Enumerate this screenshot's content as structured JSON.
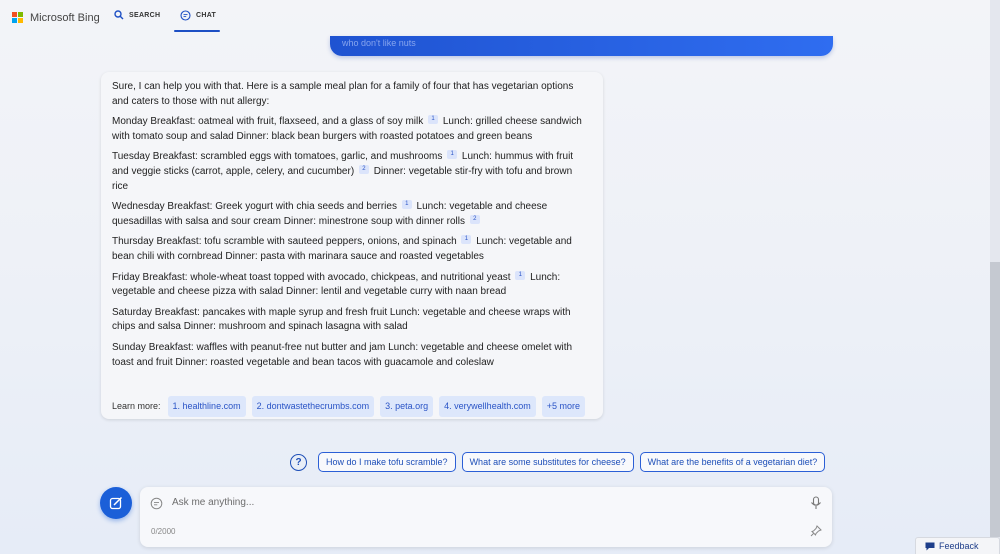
{
  "header": {
    "logo_text": "Microsoft Bing",
    "nav_search": "SEARCH",
    "nav_chat": "CHAT"
  },
  "user_bubble": {
    "text": "who don't like nuts"
  },
  "answer": {
    "intro": "Sure, I can help you with that. Here is a sample meal plan for a family of four that has vegetarian options and caters to those with nut allergy:",
    "days": [
      {
        "a": "Monday Breakfast: oatmeal with fruit, flaxseed, and a glass of soy milk",
        "c1": "1",
        "b": "Lunch: grilled cheese sandwich with tomato soup and salad Dinner: black bean burgers with roasted potatoes and green beans"
      },
      {
        "a": "Tuesday Breakfast: scrambled eggs with tomatoes, garlic, and mushrooms",
        "c1": "1",
        "b": "Lunch: hummus with fruit and veggie sticks (carrot, apple, celery, and cucumber)",
        "c2": "2",
        "c": "Dinner: vegetable stir-fry with tofu and brown rice"
      },
      {
        "a": "Wednesday Breakfast: Greek yogurt with chia seeds and berries",
        "c1": "1",
        "b": "Lunch: vegetable and cheese quesadillas with salsa and sour cream Dinner: minestrone soup with dinner rolls",
        "c2": "2"
      },
      {
        "a": "Thursday Breakfast: tofu scramble with sauteed peppers, onions, and spinach",
        "c1": "1",
        "b": "Lunch: vegetable and bean chili with cornbread Dinner: pasta with marinara sauce and roasted vegetables"
      },
      {
        "a": "Friday Breakfast: whole-wheat toast topped with avocado, chickpeas, and nutritional yeast",
        "c1": "1",
        "b": "Lunch: vegetable and cheese pizza with salad Dinner: lentil and vegetable curry with naan bread"
      },
      {
        "a": "Saturday Breakfast: pancakes with maple syrup and fresh fruit Lunch: vegetable and cheese wraps with chips and salsa Dinner: mushroom and spinach lasagna with salad"
      },
      {
        "a": "Sunday Breakfast: waffles with peanut-free nut butter and jam Lunch: vegetable and cheese omelet with toast and fruit Dinner: roasted vegetable and bean tacos with guacamole and coleslaw"
      }
    ],
    "learn_more_label": "Learn more:",
    "sources": [
      "1. healthline.com",
      "2. dontwastethecrumbs.com",
      "3. peta.org",
      "4. verywellhealth.com",
      "+5 more"
    ]
  },
  "suggestions": [
    "How do I make tofu scramble?",
    "What are some substitutes for cheese?",
    "What are the benefits of a vegetarian diet?"
  ],
  "compose": {
    "placeholder": "Ask me anything...",
    "counter": "0/2000"
  },
  "feedback_label": "Feedback",
  "colors": {
    "accent": "#1b5fd8",
    "chip_bg": "#dde7fb",
    "link": "#2a54c6"
  }
}
